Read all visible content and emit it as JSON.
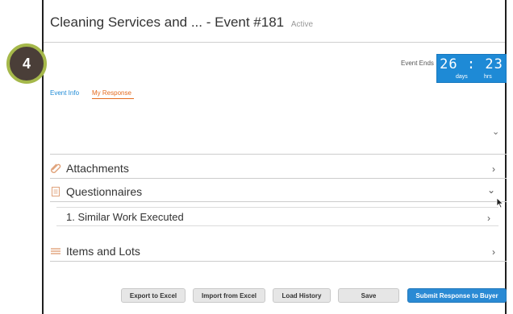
{
  "step_badge": "4",
  "title": {
    "text": "Cleaning Services and ... - Event #181",
    "status": "Active"
  },
  "event_timer": {
    "label": "Event Ends",
    "days": "26",
    "separator": ":",
    "hours": "23",
    "days_unit": "days",
    "hours_unit": "hrs",
    "color": "#1e8ad6"
  },
  "tabs": [
    {
      "label": "Event Info",
      "active": false
    },
    {
      "label": "My Response",
      "active": true
    }
  ],
  "sections": [
    {
      "label": "Attachments",
      "icon": "paperclip-icon",
      "expanded": false
    },
    {
      "label": "Questionnaires",
      "icon": "document-icon",
      "expanded": true
    },
    {
      "label": "Items and Lots",
      "icon": "list-icon",
      "expanded": false
    }
  ],
  "questionnaire_items": [
    {
      "label": "1. Similar Work Executed"
    }
  ],
  "buttons": {
    "export": "Export to Excel",
    "import": "Import from Excel",
    "load_history": "Load History",
    "save": "Save",
    "submit": "Submit Response to Buyer"
  },
  "colors": {
    "accent": "#1e8ad6",
    "active_tab": "#e46b1f",
    "badge_fill": "#4a3e38",
    "badge_ring": "#a5b84a"
  }
}
